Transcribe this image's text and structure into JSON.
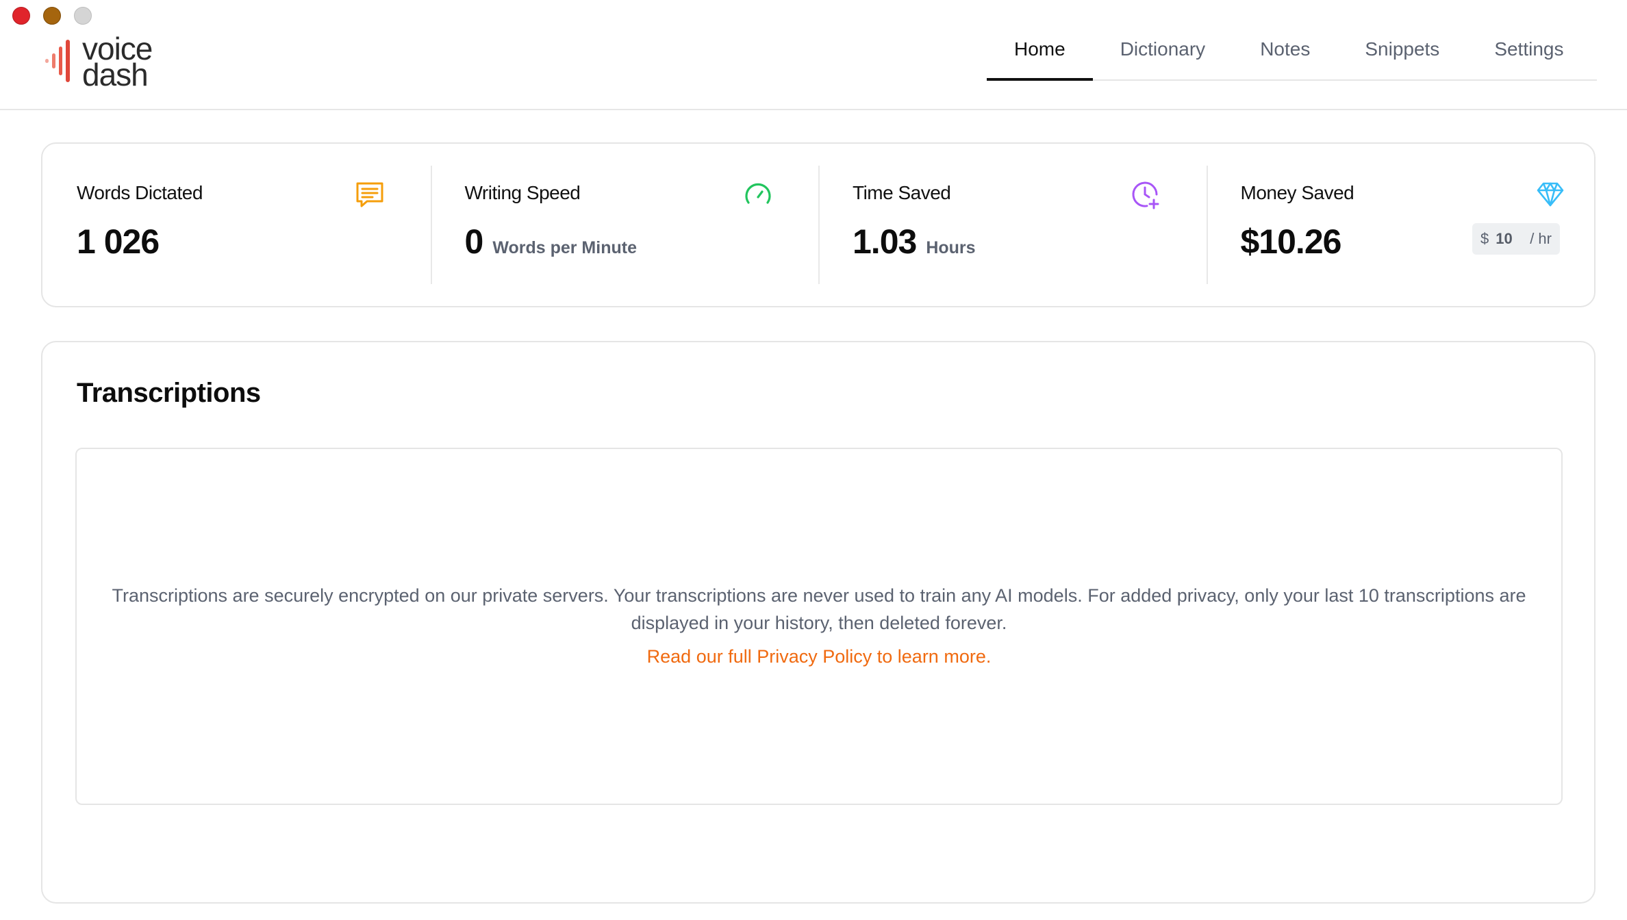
{
  "window": {
    "controls": [
      "close",
      "minimize",
      "zoom"
    ]
  },
  "logo": {
    "line1": "voice",
    "line2": "dash",
    "icon": "waveform-icon"
  },
  "nav": {
    "tabs": [
      {
        "label": "Home",
        "active": true
      },
      {
        "label": "Dictionary",
        "active": false
      },
      {
        "label": "Notes",
        "active": false
      },
      {
        "label": "Snippets",
        "active": false
      },
      {
        "label": "Settings",
        "active": false
      }
    ]
  },
  "stats": {
    "words": {
      "label": "Words Dictated",
      "value": "1 026",
      "icon": "chat-icon",
      "color": "#f59e0b"
    },
    "speed": {
      "label": "Writing Speed",
      "value": "0",
      "unit": "Words per Minute",
      "icon": "speedometer-icon",
      "color": "#22c55e"
    },
    "time": {
      "label": "Time Saved",
      "value": "1.03",
      "unit": "Hours",
      "icon": "clock-plus-icon",
      "color": "#a855f7"
    },
    "money": {
      "label": "Money Saved",
      "value": "$10.26",
      "icon": "diamond-icon",
      "color": "#38bdf8",
      "rate": {
        "currency": "$",
        "value": "10",
        "suffix": "/ hr"
      }
    }
  },
  "transcriptions": {
    "title": "Transcriptions",
    "info": "Transcriptions are securely encrypted on our private servers. Your transcriptions are never used to train any AI models. For added privacy, only your last 10 transcriptions are displayed in your history, then deleted forever.",
    "link": "Read our full Privacy Policy to learn more.",
    "link_color": "#f06a10"
  }
}
